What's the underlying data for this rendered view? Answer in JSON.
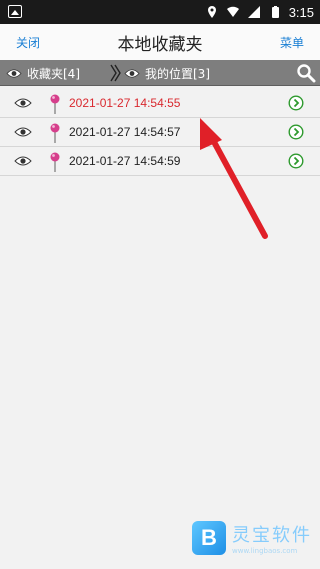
{
  "status_bar": {
    "time": "3:15",
    "icons": [
      "image-icon",
      "location-icon",
      "wifi-icon",
      "signal-icon",
      "battery-icon"
    ]
  },
  "title_bar": {
    "close_label": "关闭",
    "title": "本地收藏夹",
    "menu_label": "菜单"
  },
  "path_bar": {
    "segment1_label": "收藏夹[4]",
    "segment2_label": "我的位置[3]"
  },
  "list": {
    "items": [
      {
        "time": "2021-01-27 14:54:55",
        "selected": true
      },
      {
        "time": "2021-01-27 14:54:57",
        "selected": false
      },
      {
        "time": "2021-01-27 14:54:59",
        "selected": false
      }
    ]
  },
  "watermark": {
    "text": "灵宝软件",
    "sub": "www.lingbaos.com"
  },
  "colors": {
    "link": "#1a7fd4",
    "selected_text": "#d9292f",
    "path_bar": "#7e7e7e",
    "arrow": "#e02028",
    "go_icon": "#2e9a2e"
  }
}
